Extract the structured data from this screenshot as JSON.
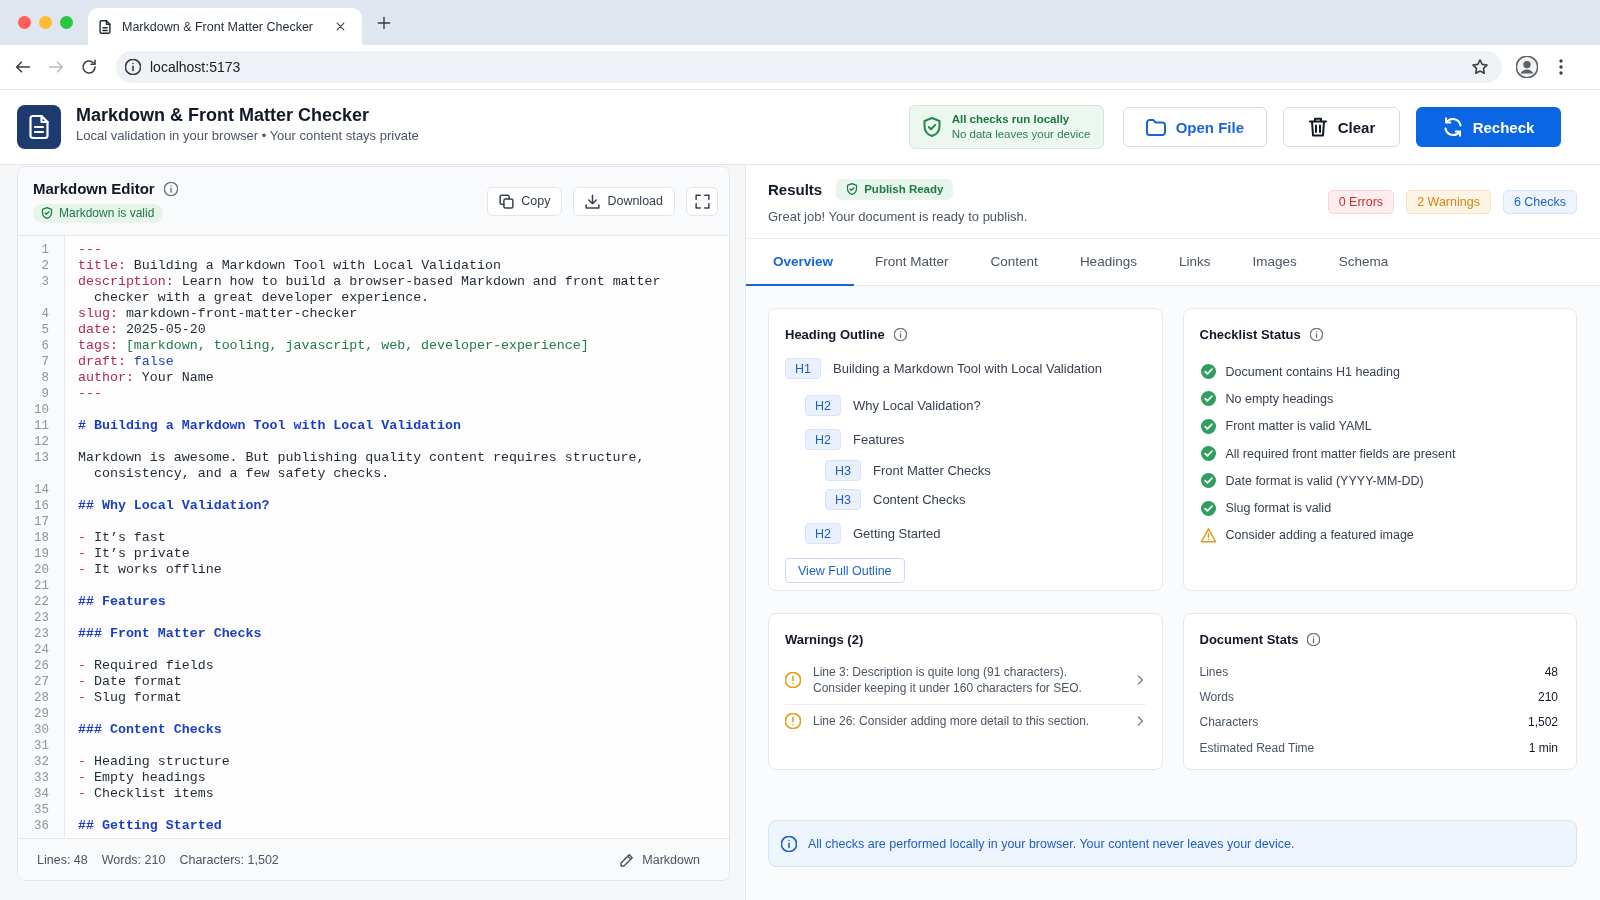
{
  "browser": {
    "tab": {
      "title": "Markdown & Front Matter Checker"
    },
    "nav": [
      {
        "kind": "back",
        "disabled": false
      },
      {
        "kind": "forward",
        "disabled": true
      },
      {
        "kind": "reload",
        "disabled": false
      }
    ],
    "url": "localhost:5173"
  },
  "header": {
    "title": "Markdown & Front Matter Checker",
    "subtitle": "Local validation in your browser • Your content stays private",
    "notice": {
      "title": "All checks run locally",
      "subtitle": "No data leaves your device"
    },
    "actions": [
      {
        "label": "Open File",
        "kind": "accent"
      },
      {
        "label": "Clear",
        "kind": "default"
      },
      {
        "label": "Recheck",
        "kind": "primary"
      }
    ]
  },
  "editor": {
    "title": "Markdown Editor",
    "status": "Markdown is valid",
    "tools": [
      {
        "label": "Copy"
      },
      {
        "label": "Download"
      }
    ],
    "lines": [
      {
        "number": "1",
        "tokens": [
          {
            "kind": "delim",
            "text": "---"
          }
        ]
      },
      {
        "number": "2",
        "tokens": [
          {
            "kind": "key",
            "text": "title:"
          },
          {
            "kind": "text",
            "text": " Building a Markdown Tool with Local Validation"
          }
        ]
      },
      {
        "number": "3",
        "tokens": [
          {
            "kind": "key",
            "text": "description:"
          },
          {
            "kind": "text",
            "text": " Learn how to build a browser-based Markdown and front matter checker with a great developer experience."
          }
        ]
      },
      {
        "number": "4",
        "tokens": [
          {
            "kind": "key",
            "text": "slug:"
          },
          {
            "kind": "text",
            "text": " markdown-front-matter-checker"
          }
        ]
      },
      {
        "number": "5",
        "tokens": [
          {
            "kind": "key",
            "text": "date:"
          },
          {
            "kind": "text",
            "text": " 2025-05-20"
          }
        ]
      },
      {
        "number": "6",
        "tokens": [
          {
            "kind": "key",
            "text": "tags:"
          },
          {
            "kind": "array",
            "text": " [markdown, tooling, javascript, web, developer-experience]"
          }
        ]
      },
      {
        "number": "7",
        "tokens": [
          {
            "kind": "key",
            "text": "draft:"
          },
          {
            "kind": "bool",
            "text": " false"
          }
        ]
      },
      {
        "number": "8",
        "tokens": [
          {
            "kind": "key",
            "text": "author:"
          },
          {
            "kind": "text",
            "text": " Your Name"
          }
        ]
      },
      {
        "number": "9",
        "tokens": [
          {
            "kind": "delim",
            "text": "---"
          }
        ]
      },
      {
        "number": "10"
      },
      {
        "number": "11",
        "tokens": [
          {
            "kind": "heading",
            "text": "# Building a Markdown Tool with Local Validation"
          }
        ]
      },
      {
        "number": "12"
      },
      {
        "number": "13",
        "tokens": [
          {
            "kind": "text",
            "text": "Markdown is awesome. But publishing quality content requires structure, consistency, and a few safety checks."
          }
        ]
      },
      {
        "number": "14"
      },
      {
        "number": "16",
        "tokens": [
          {
            "kind": "heading",
            "text": "## Why Local Validation?"
          }
        ]
      },
      {
        "number": "17"
      },
      {
        "number": "18",
        "tokens": [
          {
            "kind": "bullet",
            "text": "-"
          },
          {
            "kind": "text",
            "text": " It’s fast"
          }
        ]
      },
      {
        "number": "19",
        "tokens": [
          {
            "kind": "bullet",
            "text": "-"
          },
          {
            "kind": "text",
            "text": " It’s private"
          }
        ]
      },
      {
        "number": "20",
        "tokens": [
          {
            "kind": "bullet",
            "text": "-"
          },
          {
            "kind": "text",
            "text": " It works offline"
          }
        ]
      },
      {
        "number": "21"
      },
      {
        "number": "22",
        "tokens": [
          {
            "kind": "heading",
            "text": "## Features"
          }
        ]
      },
      {
        "number": "23"
      },
      {
        "number": "23",
        "tokens": [
          {
            "kind": "heading",
            "text": "### Front Matter Checks"
          }
        ]
      },
      {
        "number": "24"
      },
      {
        "number": "26",
        "tokens": [
          {
            "kind": "bullet",
            "text": "-"
          },
          {
            "kind": "text",
            "text": " Required fields"
          }
        ]
      },
      {
        "number": "27",
        "tokens": [
          {
            "kind": "bullet",
            "text": "-"
          },
          {
            "kind": "text",
            "text": " Date format"
          }
        ]
      },
      {
        "number": "28",
        "tokens": [
          {
            "kind": "bullet",
            "text": "-"
          },
          {
            "kind": "text",
            "text": " Slug format"
          }
        ]
      },
      {
        "number": "29"
      },
      {
        "number": "30",
        "tokens": [
          {
            "kind": "heading",
            "text": "### Content Checks"
          }
        ]
      },
      {
        "number": "31"
      },
      {
        "number": "32",
        "tokens": [
          {
            "kind": "bullet",
            "text": "-"
          },
          {
            "kind": "text",
            "text": " Heading structure"
          }
        ]
      },
      {
        "number": "33",
        "tokens": [
          {
            "kind": "bullet",
            "text": "-"
          },
          {
            "kind": "text",
            "text": " Empty headings"
          }
        ]
      },
      {
        "number": "34",
        "tokens": [
          {
            "kind": "bullet",
            "text": "-"
          },
          {
            "kind": "text",
            "text": " Checklist items"
          }
        ]
      },
      {
        "number": "35"
      },
      {
        "number": "36",
        "tokens": [
          {
            "kind": "heading",
            "text": "## Getting Started"
          }
        ]
      }
    ],
    "footer": {
      "stats": [
        "Lines: 48",
        "Words: 210",
        "Characters: 1,502"
      ],
      "mode": "Markdown"
    }
  },
  "results": {
    "title": "Results",
    "status": "Publish Ready",
    "summary": "Great job! Your document is ready to publish.",
    "counts": [
      {
        "label": "0 Errors",
        "kind": "error"
      },
      {
        "label": "2 Warnings",
        "kind": "warning"
      },
      {
        "label": "6 Checks",
        "kind": "info"
      }
    ],
    "tabs": [
      {
        "label": "Overview",
        "selected": true
      },
      {
        "label": "Front Matter",
        "selected": false
      },
      {
        "label": "Content",
        "selected": false
      },
      {
        "label": "Headings",
        "selected": false
      },
      {
        "label": "Links",
        "selected": false
      },
      {
        "label": "Images",
        "selected": false
      },
      {
        "label": "Schema",
        "selected": false
      }
    ],
    "outline": {
      "title": "Heading Outline",
      "headings": [
        {
          "level": "H1",
          "text": "Building a Markdown Tool with Local Validation",
          "children": [
            {
              "level": "H2",
              "text": "Why Local Validation?"
            },
            {
              "level": "H2",
              "text": "Features",
              "children": [
                {
                  "level": "H3",
                  "text": "Front Matter Checks"
                },
                {
                  "level": "H3",
                  "text": "Content Checks"
                }
              ]
            },
            {
              "level": "H2",
              "text": "Getting Started"
            }
          ]
        }
      ],
      "button": "View Full Outline"
    },
    "checklist": {
      "title": "Checklist Status",
      "items": [
        {
          "label": "Document contains H1 heading",
          "kind": "pass"
        },
        {
          "label": "No empty headings",
          "kind": "pass"
        },
        {
          "label": "Front matter is valid YAML",
          "kind": "pass"
        },
        {
          "label": "All required front matter fields are present",
          "kind": "pass"
        },
        {
          "label": "Date format is valid (YYYY-MM-DD)",
          "kind": "pass"
        },
        {
          "label": "Slug format is valid",
          "kind": "pass"
        },
        {
          "label": "Consider adding a featured image",
          "kind": "warning"
        }
      ]
    },
    "warnings": {
      "title": "Warnings (2)",
      "items": [
        {
          "text": "Line 3: Description is quite long (91 characters). Consider keeping it under 160 characters for SEO."
        },
        {
          "text": "Line 26: Consider adding more detail to this section."
        }
      ]
    },
    "stats": {
      "title": "Document Stats",
      "rows": [
        {
          "label": "Lines",
          "value": "48"
        },
        {
          "label": "Words",
          "value": "210"
        },
        {
          "label": "Characters",
          "value": "1,502"
        },
        {
          "label": "Estimated Read Time",
          "value": "1 min"
        }
      ]
    },
    "notice": "All checks are performed locally in your browser. Your content never leaves your device."
  }
}
